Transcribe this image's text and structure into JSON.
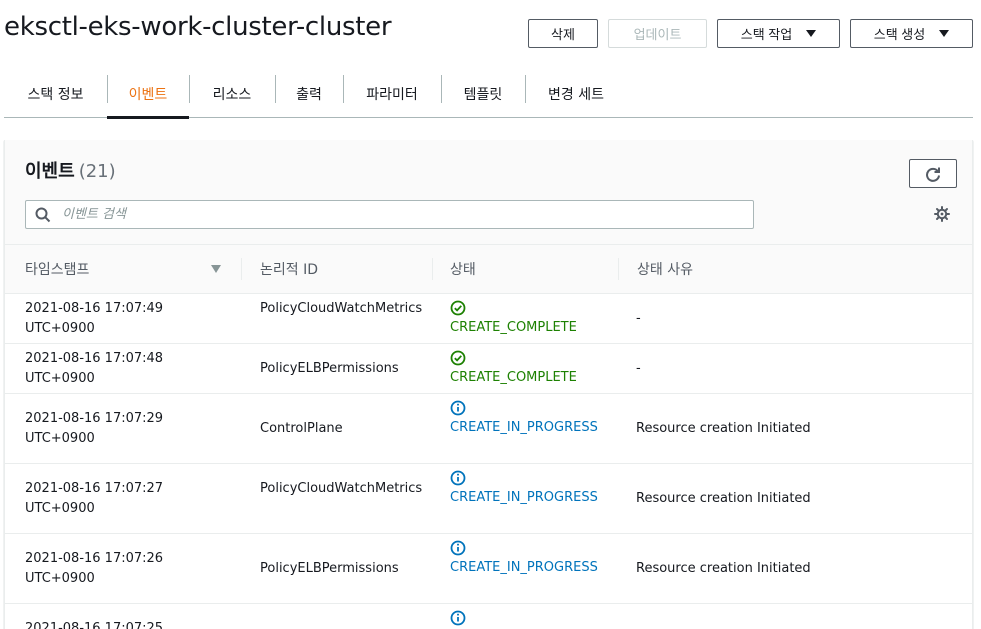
{
  "header": {
    "title": "eksctl-eks-work-cluster-cluster",
    "buttons": {
      "delete": "삭제",
      "update": "업데이트",
      "stack_actions": "스택 작업",
      "create_stack": "스택 생성"
    }
  },
  "tabs": [
    {
      "label": "스택 정보",
      "active": false
    },
    {
      "label": "이벤트",
      "active": true
    },
    {
      "label": "리소스",
      "active": false
    },
    {
      "label": "출력",
      "active": false
    },
    {
      "label": "파라미터",
      "active": false
    },
    {
      "label": "템플릿",
      "active": false
    },
    {
      "label": "변경 세트",
      "active": false
    }
  ],
  "events": {
    "title": "이벤트",
    "count": "(21)",
    "search_placeholder": "이벤트 검색",
    "columns": [
      "타임스탬프",
      "논리적 ID",
      "상태",
      "상태 사유"
    ],
    "rows": [
      {
        "timestamp": "2021-08-16 17:07:49 UTC+0900",
        "logical_id": "PolicyCloudWatchMetrics",
        "status": "CREATE_COMPLETE",
        "status_type": "complete",
        "reason": "-"
      },
      {
        "timestamp": "2021-08-16 17:07:48 UTC+0900",
        "logical_id": "PolicyELBPermissions",
        "status": "CREATE_COMPLETE",
        "status_type": "complete",
        "reason": "-"
      },
      {
        "timestamp": "2021-08-16 17:07:29 UTC+0900",
        "logical_id": "ControlPlane",
        "status": "CREATE_IN_PROGRESS",
        "status_type": "progress",
        "reason": "Resource creation Initiated"
      },
      {
        "timestamp": "2021-08-16 17:07:27 UTC+0900",
        "logical_id": "PolicyCloudWatchMetrics",
        "status": "CREATE_IN_PROGRESS",
        "status_type": "progress",
        "reason": "Resource creation Initiated"
      },
      {
        "timestamp": "2021-08-16 17:07:26 UTC+0900",
        "logical_id": "PolicyELBPermissions",
        "status": "CREATE_IN_PROGRESS",
        "status_type": "progress",
        "reason": "Resource creation Initiated"
      },
      {
        "timestamp": "2021-08-16 17:07:25",
        "logical_id": "",
        "status": "",
        "status_type": "progress",
        "reason": ""
      }
    ]
  },
  "icons": {
    "refresh": "refresh-icon",
    "search": "search-icon",
    "settings": "gear-icon",
    "sort": "sort-down-icon",
    "status_complete": "check-circle-icon",
    "status_progress": "info-circle-icon"
  },
  "colors": {
    "active_tab": "#ec7211",
    "status_complete": "#1d8102",
    "status_progress": "#0073bb"
  }
}
